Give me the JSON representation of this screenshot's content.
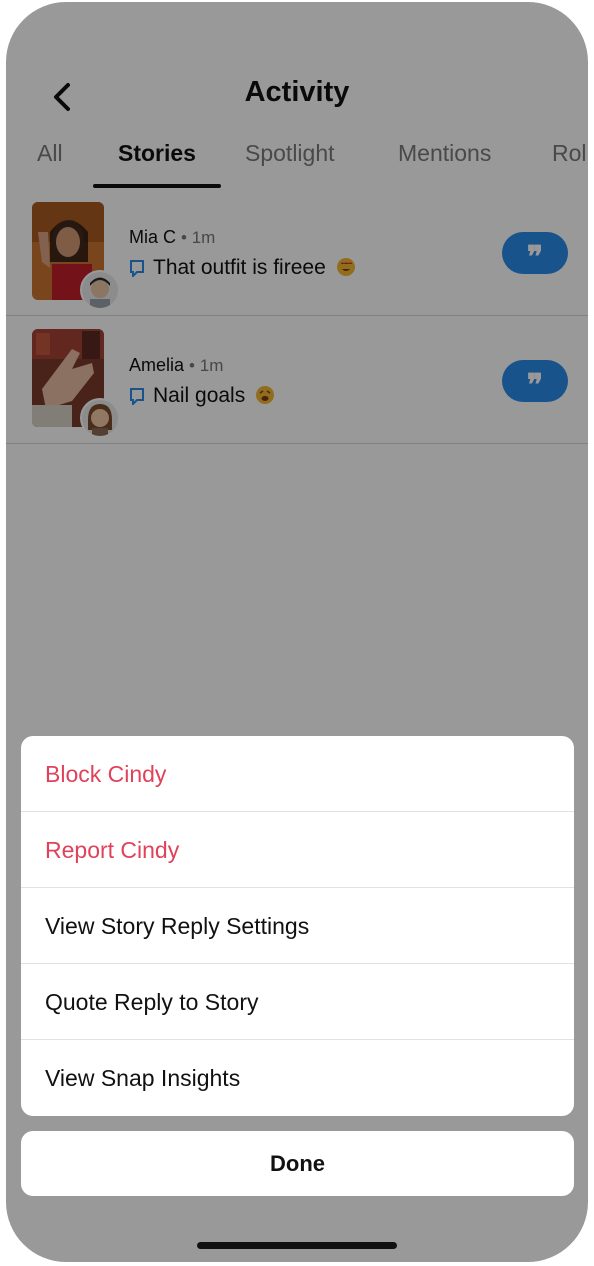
{
  "header": {
    "title": "Activity",
    "back_icon": "chevron-left-icon"
  },
  "tabs": [
    {
      "label": "All",
      "active": false
    },
    {
      "label": "Stories",
      "active": true
    },
    {
      "label": "Spotlight",
      "active": false
    },
    {
      "label": "Mentions",
      "active": false
    },
    {
      "label": "Rol",
      "active": false
    }
  ],
  "activity": [
    {
      "name": "Mia C",
      "separator": "•",
      "time": "1m",
      "message": "That outfit is fireee",
      "emoji": "heart-eyes-emoji",
      "quote_icon": "quote-icon"
    },
    {
      "name": "Amelia",
      "separator": "•",
      "time": "1m",
      "message": "Nail goals",
      "emoji": "weary-face-emoji",
      "quote_icon": "quote-icon"
    }
  ],
  "action_sheet": {
    "items": [
      {
        "label": "Block Cindy",
        "style": "danger"
      },
      {
        "label": "Report Cindy",
        "style": "danger"
      },
      {
        "label": "View Story Reply Settings",
        "style": "normal"
      },
      {
        "label": "Quote Reply to Story",
        "style": "normal"
      },
      {
        "label": "View Snap Insights",
        "style": "normal"
      }
    ],
    "done_label": "Done"
  },
  "colors": {
    "accent": "#2a8be8",
    "danger": "#e0425a",
    "dim_overlay": "rgba(0,0,0,0.40)"
  }
}
